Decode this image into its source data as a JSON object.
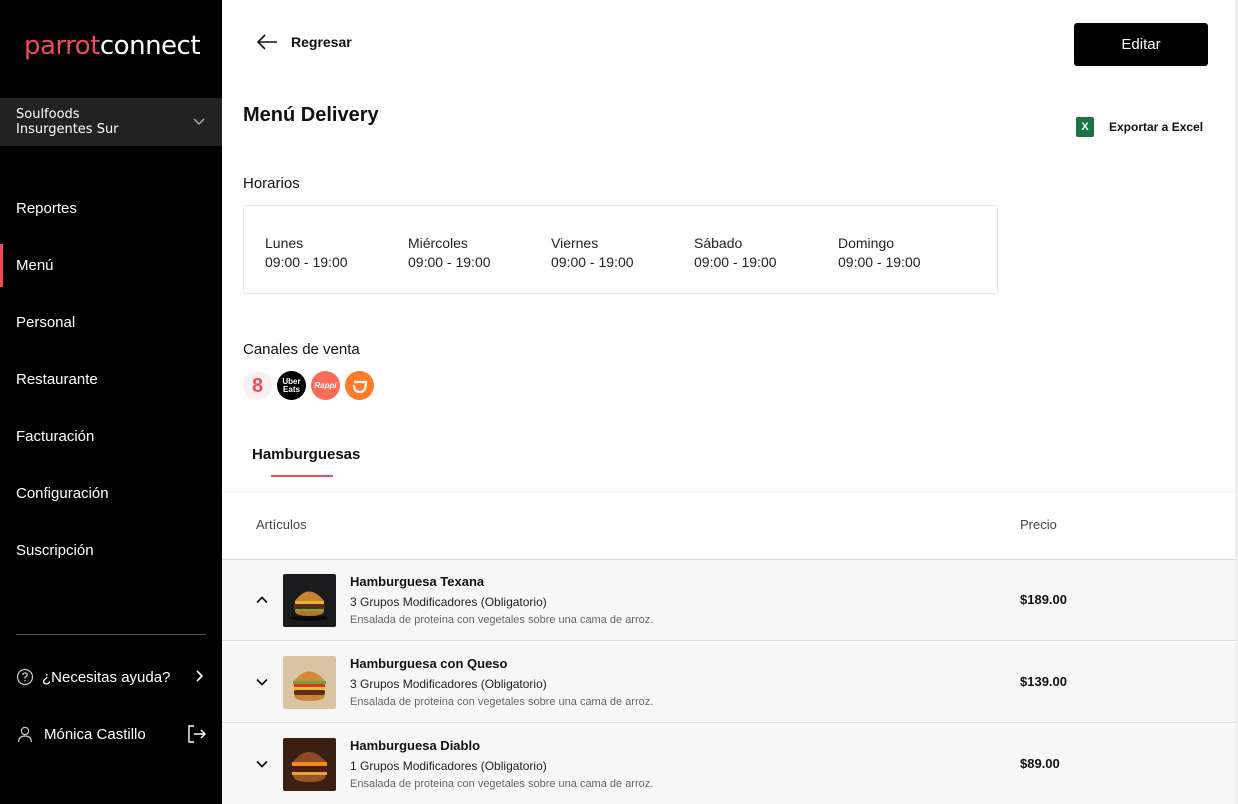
{
  "sidebar": {
    "logo_part1": "parrot",
    "logo_part2": "connect",
    "store_name": "Soulfoods\nInsurgentes Sur",
    "nav": [
      {
        "label": "Reportes"
      },
      {
        "label": "Menú"
      },
      {
        "label": "Personal"
      },
      {
        "label": "Restaurante"
      },
      {
        "label": "Facturación"
      },
      {
        "label": "Configuración"
      },
      {
        "label": "Suscripción"
      }
    ],
    "active_item": "Menú",
    "help_label": "¿Necesitas ayuda?",
    "user_name": "Mónica Castillo"
  },
  "header": {
    "back_label": "Regresar",
    "edit_label": "Editar",
    "page_title": "Menú Delivery",
    "export_label": "Exportar a Excel"
  },
  "schedule": {
    "label": "Horarios",
    "days": [
      {
        "day": "Lunes",
        "hours": "09:00 - 19:00"
      },
      {
        "day": "Miércoles",
        "hours": "09:00 - 19:00"
      },
      {
        "day": "Viernes",
        "hours": "09:00 - 19:00"
      },
      {
        "day": "Sábado",
        "hours": "09:00 - 19:00"
      },
      {
        "day": "Domingo",
        "hours": "09:00 - 19:00"
      }
    ]
  },
  "channels": {
    "label": "Canales de venta",
    "items": [
      {
        "name": "parrot-channel",
        "text": "8"
      },
      {
        "name": "uber-eats-channel",
        "text": "Uber Eats"
      },
      {
        "name": "rappi-channel",
        "text": "Rappi"
      },
      {
        "name": "didi-channel",
        "text": ""
      }
    ]
  },
  "tabs": [
    {
      "label": "Hamburguesas"
    }
  ],
  "table": {
    "columns": [
      "Artículos",
      "Precio"
    ],
    "rows": [
      {
        "name": "Hamburguesa Texana",
        "mods": "3 Grupos Modificadores (Obligatorio)",
        "desc": "Ensalada de proteina con vegetales sobre una cama de arroz.",
        "price": "$189.00",
        "expanded": true
      },
      {
        "name": "Hamburguesa con Queso",
        "mods": "3 Grupos Modificadores (Obligatorio)",
        "desc": "Ensalada de proteina con vegetales sobre una cama de arroz.",
        "price": "$139.00",
        "expanded": false
      },
      {
        "name": "Hamburguesa Diablo",
        "mods": "1 Grupos Modificadores (Obligatorio)",
        "desc": "Ensalada de proteina con vegetales sobre una cama de arroz.",
        "price": "$89.00",
        "expanded": false
      }
    ]
  },
  "colors": {
    "accent": "#f04b54",
    "sidebar_bg": "#000000",
    "store_bg": "#222222",
    "excel_green": "#1f7244"
  }
}
